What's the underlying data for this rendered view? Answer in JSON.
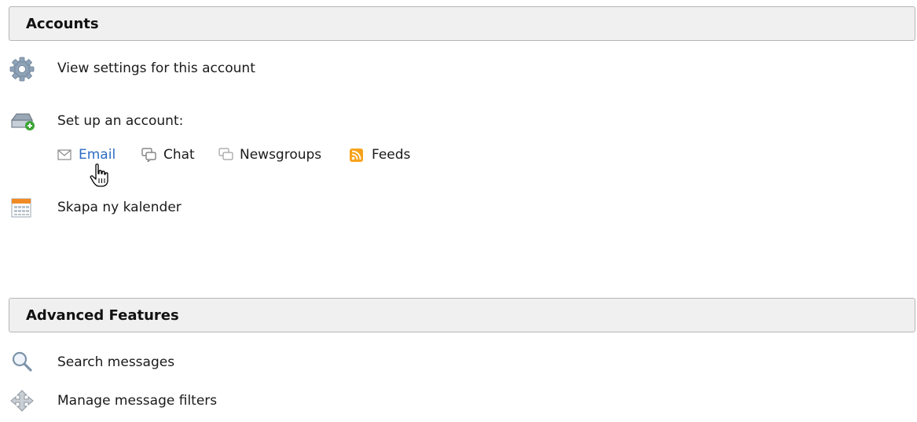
{
  "accounts": {
    "title": "Accounts",
    "view_settings": "View settings for this account",
    "setup_label": "Set up an account:",
    "setup_links": [
      {
        "label": "Email",
        "icon": "envelope-icon"
      },
      {
        "label": "Chat",
        "icon": "chat-icon"
      },
      {
        "label": "Newsgroups",
        "icon": "newsgroups-icon"
      },
      {
        "label": "Feeds",
        "icon": "rss-icon"
      }
    ],
    "new_calendar": "Skapa ny kalender"
  },
  "advanced": {
    "title": "Advanced Features",
    "search": "Search messages",
    "filters": "Manage message filters"
  },
  "colors": {
    "link_active": "#2b6cc4",
    "header_bg": "#f0f0f0",
    "rss_orange": "#f7a21b",
    "calendar_orange": "#f08a24"
  }
}
